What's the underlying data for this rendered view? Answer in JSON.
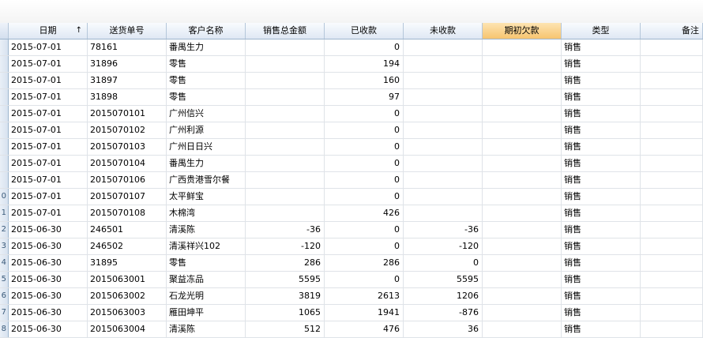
{
  "columns": [
    "日期",
    "送货单号",
    "客户名称",
    "销售总金额",
    "已收款",
    "未收款",
    "期初欠款",
    "类型",
    "备注"
  ],
  "sort_indicator": "↑",
  "rows": [
    {
      "rn": "",
      "date": "2015-07-01",
      "order": "78161",
      "customer": "番禺生力",
      "total": "",
      "received": "0",
      "unpaid": "",
      "opening": "",
      "type": "销售",
      "note": ""
    },
    {
      "rn": "",
      "date": "2015-07-01",
      "order": "31896",
      "customer": "零售",
      "total": "",
      "received": "194",
      "unpaid": "",
      "opening": "",
      "type": "销售",
      "note": ""
    },
    {
      "rn": "",
      "date": "2015-07-01",
      "order": "31897",
      "customer": "零售",
      "total": "",
      "received": "160",
      "unpaid": "",
      "opening": "",
      "type": "销售",
      "note": ""
    },
    {
      "rn": "",
      "date": "2015-07-01",
      "order": "31898",
      "customer": "零售",
      "total": "",
      "received": "97",
      "unpaid": "",
      "opening": "",
      "type": "销售",
      "note": ""
    },
    {
      "rn": "",
      "date": "2015-07-01",
      "order": "2015070101",
      "customer": "广州信兴",
      "total": "",
      "received": "0",
      "unpaid": "",
      "opening": "",
      "type": "销售",
      "note": ""
    },
    {
      "rn": "",
      "date": "2015-07-01",
      "order": "2015070102",
      "customer": "广州利源",
      "total": "",
      "received": "0",
      "unpaid": "",
      "opening": "",
      "type": "销售",
      "note": ""
    },
    {
      "rn": "",
      "date": "2015-07-01",
      "order": "2015070103",
      "customer": "广州日日兴",
      "total": "",
      "received": "0",
      "unpaid": "",
      "opening": "",
      "type": "销售",
      "note": ""
    },
    {
      "rn": "",
      "date": "2015-07-01",
      "order": "2015070104",
      "customer": "番禺生力",
      "total": "",
      "received": "0",
      "unpaid": "",
      "opening": "",
      "type": "销售",
      "note": ""
    },
    {
      "rn": "",
      "date": "2015-07-01",
      "order": "2015070106",
      "customer": "广西贵港雪尔餐",
      "total": "",
      "received": "0",
      "unpaid": "",
      "opening": "",
      "type": "销售",
      "note": ""
    },
    {
      "rn": "0",
      "date": "2015-07-01",
      "order": "2015070107",
      "customer": "太平鲜宝",
      "total": "",
      "received": "0",
      "unpaid": "",
      "opening": "",
      "type": "销售",
      "note": ""
    },
    {
      "rn": "1",
      "date": "2015-07-01",
      "order": "2015070108",
      "customer": "木棉湾",
      "total": "",
      "received": "426",
      "unpaid": "",
      "opening": "",
      "type": "销售",
      "note": ""
    },
    {
      "rn": "2",
      "date": "2015-06-30",
      "order": "246501",
      "customer": "清溪陈",
      "total": "-36",
      "received": "0",
      "unpaid": "-36",
      "opening": "",
      "type": "销售",
      "note": ""
    },
    {
      "rn": "3",
      "date": "2015-06-30",
      "order": "246502",
      "customer": "清溪祥兴102",
      "total": "-120",
      "received": "0",
      "unpaid": "-120",
      "opening": "",
      "type": "销售",
      "note": ""
    },
    {
      "rn": "4",
      "date": "2015-06-30",
      "order": "31895",
      "customer": "零售",
      "total": "286",
      "received": "286",
      "unpaid": "0",
      "opening": "",
      "type": "销售",
      "note": ""
    },
    {
      "rn": "5",
      "date": "2015-06-30",
      "order": "2015063001",
      "customer": "聚益冻品",
      "total": "5595",
      "received": "0",
      "unpaid": "5595",
      "opening": "",
      "type": "销售",
      "note": ""
    },
    {
      "rn": "6",
      "date": "2015-06-30",
      "order": "2015063002",
      "customer": "石龙光明",
      "total": "3819",
      "received": "2613",
      "unpaid": "1206",
      "opening": "",
      "type": "销售",
      "note": ""
    },
    {
      "rn": "7",
      "date": "2015-06-30",
      "order": "2015063003",
      "customer": "雁田坤平",
      "total": "1065",
      "received": "1941",
      "unpaid": "-876",
      "opening": "",
      "type": "销售",
      "note": ""
    },
    {
      "rn": "8",
      "date": "2015-06-30",
      "order": "2015063004",
      "customer": "清溪陈",
      "total": "512",
      "received": "476",
      "unpaid": "36",
      "opening": "",
      "type": "销售",
      "note": ""
    }
  ]
}
